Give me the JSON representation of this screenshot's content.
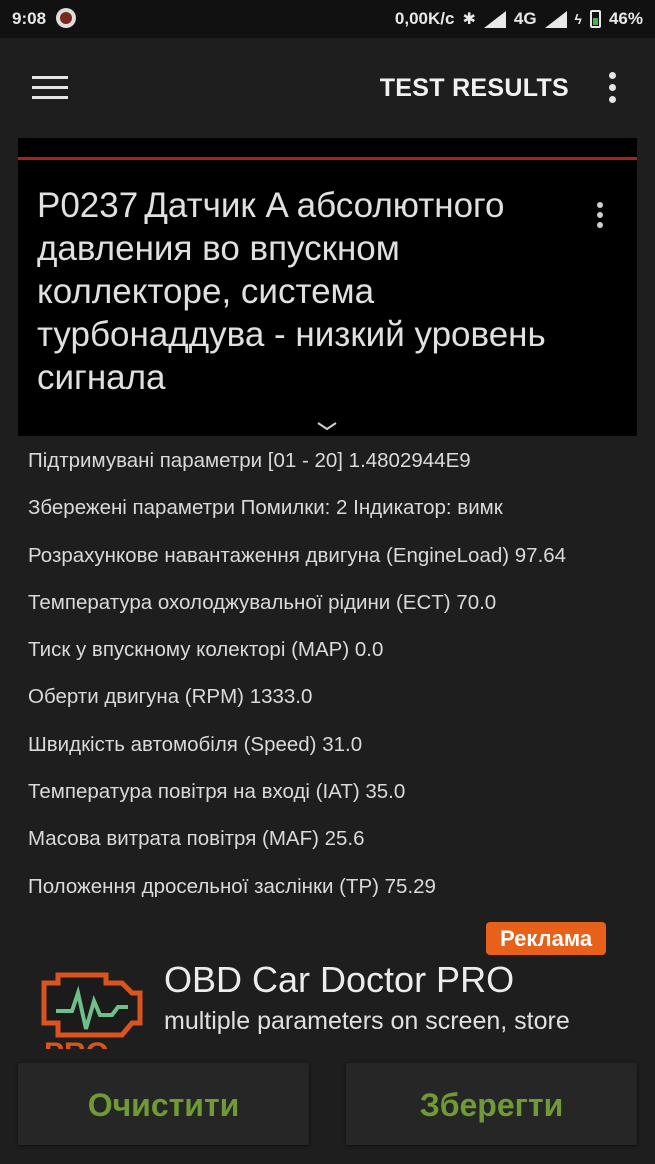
{
  "status_bar": {
    "time": "9:08",
    "speed": "0,00K/c",
    "network": "4G",
    "battery": "46%"
  },
  "app_bar": {
    "title": "TEST RESULTS",
    "menu_icon": "hamburger-icon",
    "overflow_icon": "more-vert-icon"
  },
  "dtc_card": {
    "code": "P0237",
    "description": "Датчик A абсолютного давления во впускном коллекторе, система турбонаддува - низкий уровень сигнала",
    "accent_color": "#b71c1c"
  },
  "parameters": [
    "Підтримувані параметри [01 - 20] 1.4802944E9",
    "Збережені параметри Помилки: 2 Індикатор: вимк",
    "Розрахункове навантаження двигуна (EngineLoad) 97.64",
    "Температура охолоджувальної рідини (ECT) 70.0",
    "Тиск у впускному колекторі (MAP) 0.0",
    "Оберти двигуна (RPM) 1333.0",
    "Швидкість автомобіля (Speed) 31.0",
    "Температура повітря на вході (IAT) 35.0",
    "Масова витрата повітря (MAF) 25.6",
    "Положення дросельної заслінки (TP) 75.29"
  ],
  "ad": {
    "badge": "Реклама",
    "title": "OBD Car Doctor PRO",
    "subtitle": "multiple parameters on screen, store",
    "logo_text": "PRO",
    "badge_color": "#e8611a"
  },
  "buttons": {
    "clear": "Очистити",
    "save": "Зберегти",
    "text_color": "#6f9a35"
  }
}
